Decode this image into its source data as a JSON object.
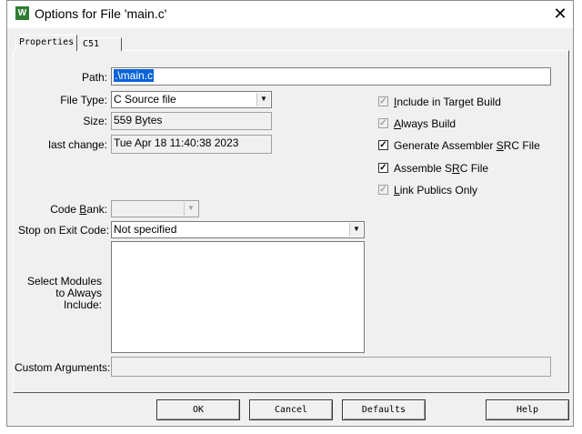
{
  "window": {
    "title": "Options for File 'main.c'",
    "close_glyph": "✕",
    "icon_letter": "W"
  },
  "tabs": [
    {
      "label": "Properties",
      "active": true
    },
    {
      "label": "C51",
      "active": false
    }
  ],
  "form": {
    "path_label": "Path:",
    "path_value": ".\\main.c",
    "file_type_label": "File Type:",
    "file_type_value": "C Source file",
    "size_label": "Size:",
    "size_value": "559 Bytes",
    "last_change_label": "last change:",
    "last_change_value": "Tue Apr 18 11:40:38 2023",
    "code_bank_label_pre": "Code ",
    "code_bank_label_ul": "B",
    "code_bank_label_post": "ank:",
    "code_bank_value": "",
    "stop_label": "Stop on Exit Code:",
    "stop_value": "Not specified",
    "modules_label_1": "Select Modules",
    "modules_label_2": "to Always",
    "modules_label_3": "Include:",
    "custom_args_label_pre": "Custom Ar",
    "custom_args_label_ul": "g",
    "custom_args_label_post": "uments:",
    "custom_args_value": ""
  },
  "checkboxes": {
    "include_pre": "",
    "include_ul": "I",
    "include_post": "nclude in Target Build",
    "include_checked": true,
    "include_disabled": true,
    "always_pre": "",
    "always_ul": "A",
    "always_post": "lways Build",
    "always_checked": true,
    "always_disabled": true,
    "gen_asm_pre": "Generate Assembler ",
    "gen_asm_ul": "S",
    "gen_asm_post": "RC File",
    "gen_asm_checked": true,
    "gen_asm_disabled": false,
    "asm_src_pre": "Assemble S",
    "asm_src_ul": "R",
    "asm_src_post": "C File",
    "asm_src_checked": true,
    "asm_src_disabled": false,
    "link_pre": "",
    "link_ul": "L",
    "link_post": "ink Publics Only",
    "link_checked": true,
    "link_disabled": true
  },
  "buttons": {
    "ok": "OK",
    "cancel": "Cancel",
    "defaults": "Defaults",
    "help": "Help"
  },
  "icons": {
    "combo_arrow": "▼",
    "check_mark": "✓"
  }
}
